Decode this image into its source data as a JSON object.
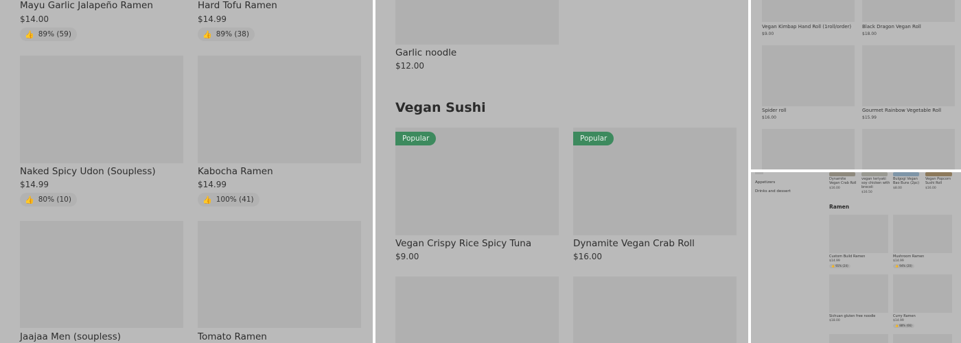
{
  "panel1": {
    "items": [
      {
        "name": "Mayu Garlic Jalapeño Ramen",
        "price": "$14.00",
        "rating": "89% (59)"
      },
      {
        "name": "Hard Tofu Ramen",
        "price": "$14.99",
        "rating": "89% (38)"
      },
      {
        "name": "Naked Spicy Udon (Soupless)",
        "price": "$14.99",
        "rating": "80% (10)"
      },
      {
        "name": "Kabocha Ramen",
        "price": "$14.99",
        "rating": "100% (41)"
      },
      {
        "name": "Jaajaa Men (soupless)"
      },
      {
        "name": "Tomato Ramen"
      }
    ]
  },
  "panel2": {
    "items": [
      {
        "name": "Garlic noodle",
        "price": "$12.00"
      },
      {
        "name": "Vegan Crispy Rice Spicy Tuna",
        "price": "$9.00",
        "badge": "Popular"
      },
      {
        "name": "Dynamite Vegan Crab Roll",
        "price": "$16.00",
        "badge": "Popular"
      }
    ],
    "section_heading": "Vegan Sushi"
  },
  "panel3": {
    "items": [
      {
        "name": "Vegan Kimbap Hand Roll  (1roll/order)",
        "price": "$9.00"
      },
      {
        "name": "Black Dragon Vegan Roll",
        "price": "$18.00"
      },
      {
        "name": "Spider roll",
        "price": "$16.00"
      },
      {
        "name": "Gourmet Rainbow Vegetable Roll",
        "price": "$15.99"
      }
    ]
  },
  "panel4": {
    "sidebar": [
      "Appetizers",
      "Drinks and dessert"
    ],
    "top_items": [
      {
        "name": "Dynamite Vegan Crab Roll",
        "price": "$16.00"
      },
      {
        "name": "vegan teriyaki soy chicken with brocoli",
        "price": "$16.50"
      },
      {
        "name": "Bulgogi Vegan Bao Buns (2pc)",
        "price": "$8.00"
      },
      {
        "name": "Vegan Popcorn Sushi Roll",
        "price": "$16.00"
      }
    ],
    "section_heading": "Ramen",
    "items": [
      {
        "name": "Custom Build Ramen",
        "price": "$14.99",
        "rating": "91% (24)"
      },
      {
        "name": "Mushroom Ramen",
        "price": "$14.99",
        "rating": "94% (20)"
      },
      {
        "name": "Sichuan gluten free noodle",
        "price": "$18.00"
      },
      {
        "name": "Curry Ramen",
        "price": "$14.99",
        "rating": "88% (66)"
      }
    ]
  },
  "icons": {
    "rating": "thumbs-up-icon"
  },
  "colors": {
    "popular_badge": "#3d8a5e",
    "background_overlay": "#bababa",
    "image_placeholder": "#b0b0b0"
  }
}
